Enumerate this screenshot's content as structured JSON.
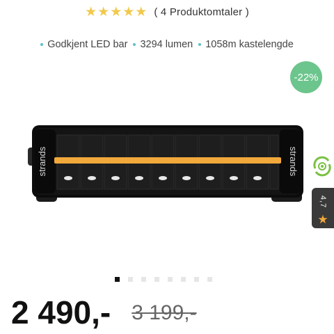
{
  "rating": {
    "stars": 5,
    "reviews_text": "( 4  Produktomtaler )"
  },
  "features": [
    {
      "label": "Godkjent LED bar"
    },
    {
      "label": "3294 lumen"
    },
    {
      "label": "1058m kastelengde"
    }
  ],
  "discount_badge": "-22%",
  "product_image": {
    "brand_text": "strands"
  },
  "rating_tab": {
    "value": "4,7"
  },
  "carousel": {
    "active_index": 0,
    "count": 8
  },
  "price": {
    "current": "2 490,-",
    "old": "3 199,-"
  },
  "colors": {
    "star": "#f2c94c",
    "accent_dot": "#5bc0c8",
    "discount": "#6cc58c",
    "amber": "#f2a93b"
  }
}
